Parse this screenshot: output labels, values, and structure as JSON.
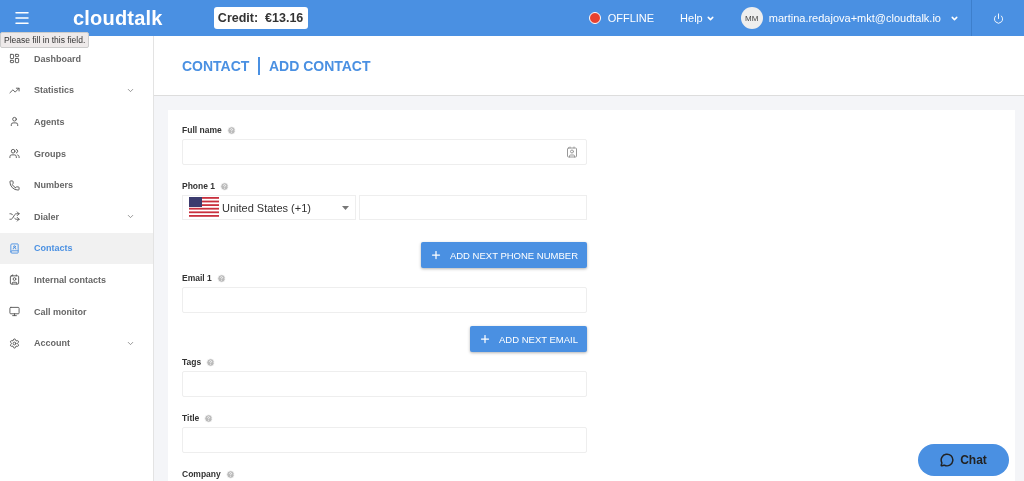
{
  "topbar": {
    "logo": "cloudtalk",
    "credit": "Credit:  €13.16",
    "status": {
      "label": "OFFLINE",
      "online": false
    },
    "help": "Help",
    "user": {
      "initials": "MM",
      "email": "martina.redajova+mkt@cloudtalk.io"
    }
  },
  "tooltip": "Please fill in this field.",
  "sidebar": {
    "items": [
      {
        "label": "Dashboard",
        "expandable": false,
        "selected": false
      },
      {
        "label": "Statistics",
        "expandable": true,
        "selected": false
      },
      {
        "label": "Agents",
        "expandable": false,
        "selected": false
      },
      {
        "label": "Groups",
        "expandable": false,
        "selected": false
      },
      {
        "label": "Numbers",
        "expandable": false,
        "selected": false
      },
      {
        "label": "Dialer",
        "expandable": true,
        "selected": false
      },
      {
        "label": "Contacts",
        "expandable": false,
        "selected": true
      },
      {
        "label": "Internal contacts",
        "expandable": false,
        "selected": false
      },
      {
        "label": "Call monitor",
        "expandable": false,
        "selected": false
      },
      {
        "label": "Account",
        "expandable": true,
        "selected": false
      }
    ]
  },
  "breadcrumb": [
    "CONTACT",
    "ADD CONTACT"
  ],
  "form": [
    {
      "kind": "text",
      "label": "Full name",
      "card_icon": true
    },
    {
      "kind": "phone",
      "label": "Phone 1",
      "country": "United States (+1)"
    },
    {
      "kind": "button",
      "label": "ADD NEXT PHONE NUMBER"
    },
    {
      "kind": "text",
      "label": "Email 1",
      "card_icon": false
    },
    {
      "kind": "button",
      "label": "ADD NEXT EMAIL"
    },
    {
      "kind": "text",
      "label": "Tags",
      "card_icon": false
    },
    {
      "kind": "text",
      "label": "Title",
      "card_icon": false
    },
    {
      "kind": "label",
      "label": "Company"
    }
  ],
  "chat": "Chat"
}
